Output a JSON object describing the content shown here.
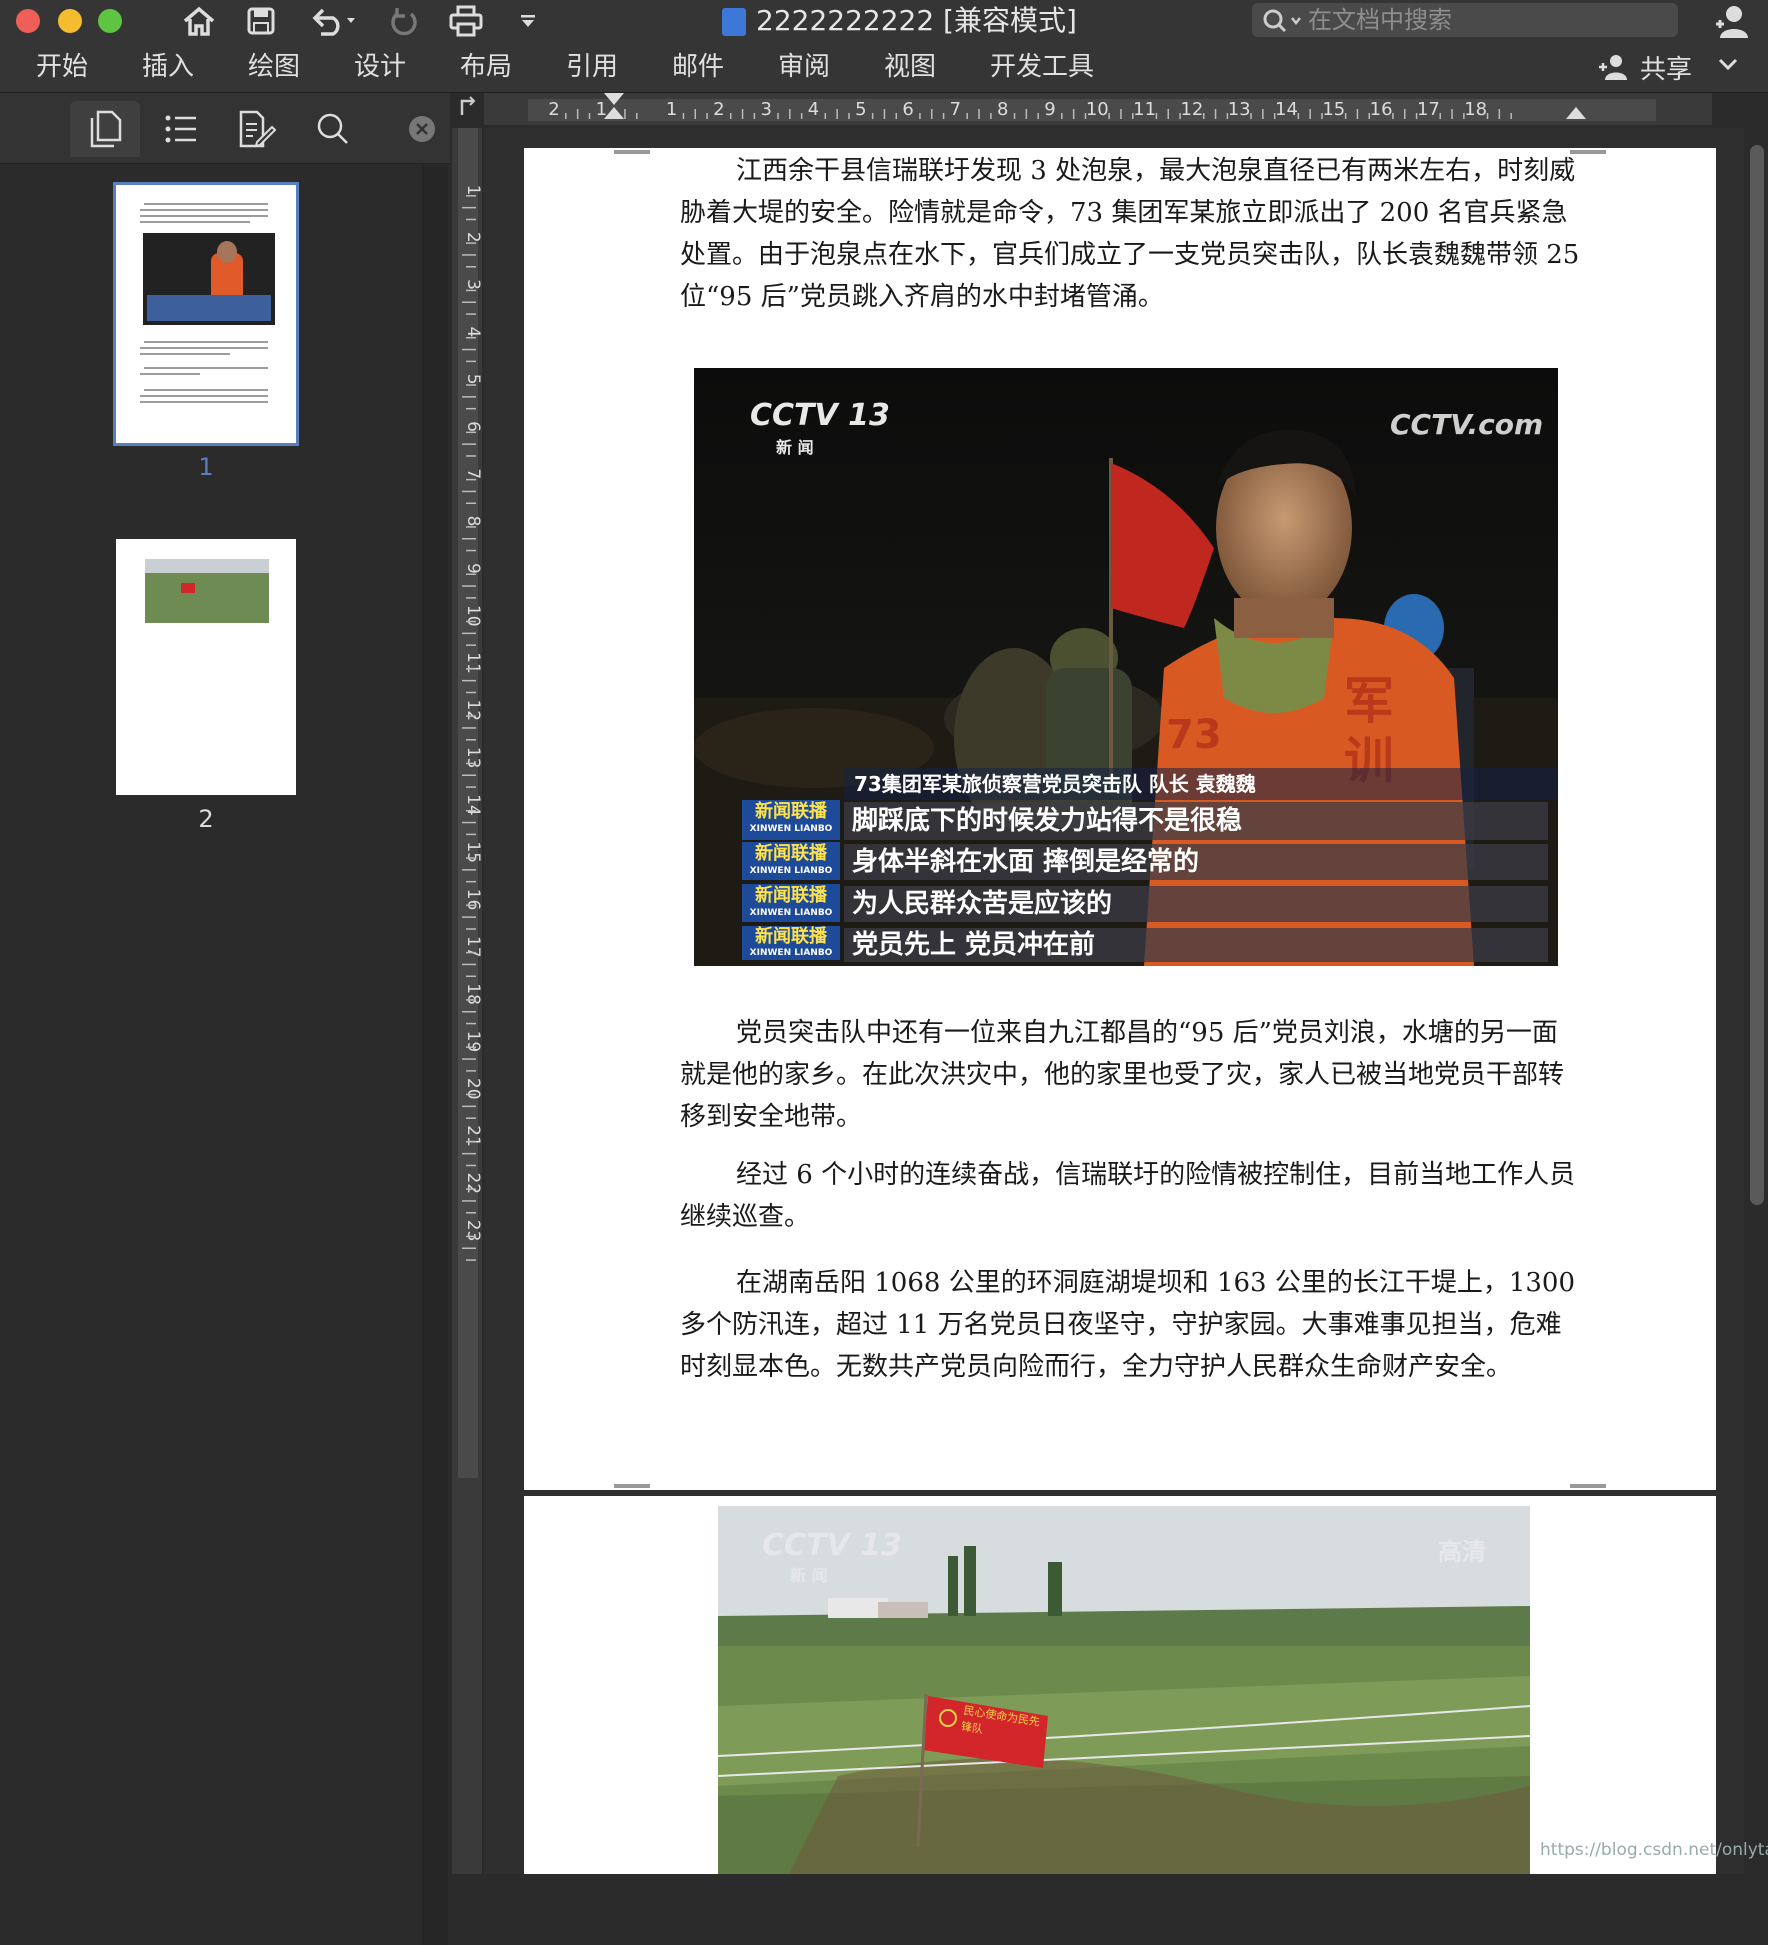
{
  "window": {
    "title": "2222222222 [兼容模式]",
    "search_placeholder": "在文档中搜索"
  },
  "toolbar_icons": [
    "home-icon",
    "save-icon",
    "undo-icon",
    "redo-icon",
    "print-icon",
    "customize-icon"
  ],
  "ribbon": {
    "tabs": [
      "开始",
      "插入",
      "绘图",
      "设计",
      "布局",
      "引用",
      "邮件",
      "审阅",
      "视图",
      "开发工具"
    ],
    "share_label": "共享"
  },
  "nav": {
    "pages": [
      "1",
      "2"
    ]
  },
  "ruler": {
    "h_labels": [
      "2",
      "1",
      "1",
      "2",
      "3",
      "4",
      "5",
      "6",
      "7",
      "8",
      "9",
      "10",
      "11",
      "12",
      "13",
      "14",
      "15",
      "16",
      "17",
      "18"
    ],
    "v_labels": [
      "1",
      "2",
      "3",
      "4",
      "5",
      "6",
      "7",
      "8",
      "9",
      "10",
      "11",
      "12",
      "13",
      "14",
      "15",
      "16",
      "17",
      "18",
      "19",
      "20",
      "21",
      "22",
      "23"
    ]
  },
  "document": {
    "p1": "江西余干县信瑞联圩发现 3 处泡泉，最大泡泉直径已有两米左右，时刻威胁着大堤的安全。险情就是命令，73 集团军某旅立即派出了 200 名官兵紧急处置。由于泡泉点在水下，官兵们成立了一支党员突击队，队长袁魏魏带领 25 位“95 后”党员跳入齐肩的水中封堵管涌。",
    "p2": "党员突击队中还有一位来自九江都昌的“95 后”党员刘浪，水塘的另一面就是他的家乡。在此次洪灾中，他的家里也受了灾，家人已被当地党员干部转移到安全地带。",
    "p3": "经过 6 个小时的连续奋战，信瑞联圩的险情被控制住，目前当地工作人员继续巡查。",
    "p4": "在湖南岳阳 1068 公里的环洞庭湖堤坝和 163 公里的长江干堤上，1300 多个防汛连，超过 11 万名党员日夜坚守，守护家园。大事难事见担当，危难时刻显本色。无数共产党员向险而行，全力守护人民群众生命财产安全。"
  },
  "image1": {
    "channel_logo": "CCTV 13",
    "channel_sub": "新 闻",
    "corner_logo": "CCTV.com",
    "caption_name": "73集团军某旅侦察营党员突击队 队长 袁魏魏",
    "program_badge": "新闻联播",
    "program_badge_pinyin": "XINWEN LIANBO",
    "subtitles": [
      "脚踩底下的时候发力站得不是很稳",
      "身体半斜在水面 摔倒是经常的",
      "为人民群众苦是应该的",
      "党员先上 党员冲在前"
    ]
  },
  "image2": {
    "channel_logo": "CCTV 13",
    "channel_sub": "新 闻",
    "corner_logo": "高清",
    "flag_text": "民心使命为民先锋队"
  },
  "watermark": "https://blog.csdn.net/onlytanny",
  "colors": {
    "chrome": "#353535",
    "accent_blue": "#3d78d8",
    "caption_blue": "#1e4a9a"
  }
}
